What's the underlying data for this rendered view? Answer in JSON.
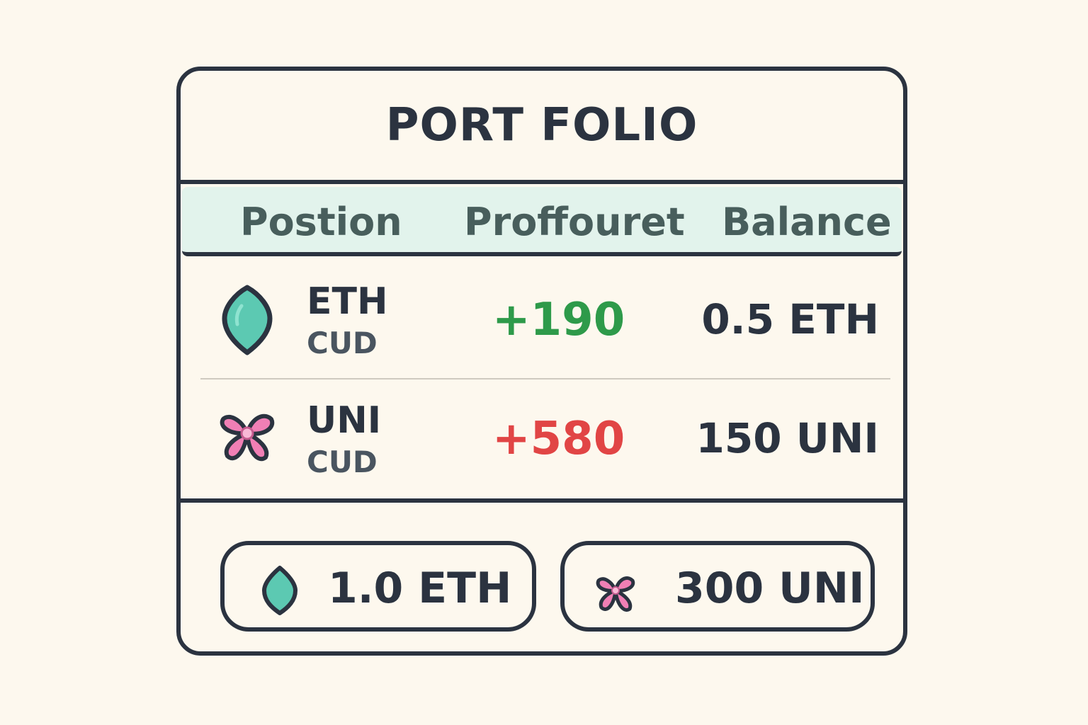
{
  "portfolio": {
    "title": "PORT FOLIO",
    "columns": {
      "position": "Postion",
      "profit": "Proffouret",
      "balance": "Balance"
    },
    "rows": [
      {
        "symbol": "ETH",
        "sub": "CUD",
        "profit": "+190",
        "profit_color": "#2e9a4a",
        "balance": "0.5 ETH",
        "icon": "eth-gem-icon"
      },
      {
        "symbol": "UNI",
        "sub": "CUD",
        "profit": "+580",
        "profit_color": "#e14545",
        "balance": "150 UNI",
        "icon": "uni-flower-icon"
      }
    ],
    "totals": [
      {
        "label": "1.0 ETH",
        "icon": "eth-gem-icon"
      },
      {
        "label": "300 UNI",
        "icon": "uni-flower-icon"
      }
    ]
  },
  "colors": {
    "background": "#fdf8ee",
    "outline": "#2b3340",
    "header_bg": "#e2f3ec",
    "eth_teal": "#5cc9b2",
    "uni_pink": "#f07fb5"
  }
}
